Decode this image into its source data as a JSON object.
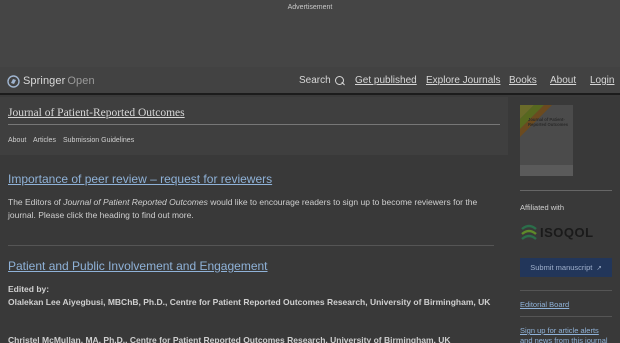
{
  "advertisement": {
    "label": "Advertisement"
  },
  "header": {
    "logo": {
      "brand": "Springer",
      "suffix": "Open"
    },
    "nav": {
      "search": "Search",
      "get_published": "Get published",
      "explore_journals": "Explore Journals",
      "books": "Books",
      "about": "About",
      "login": "Login"
    }
  },
  "journal": {
    "title": "Journal of Patient-Reported Outcomes",
    "subnav": [
      "About",
      "Articles",
      "Submission Guidelines"
    ]
  },
  "main": {
    "article1": {
      "heading": "Importance of peer review – request for reviewers",
      "text_before": "The Editors of ",
      "text_italic": "Journal of Patient Reported Outcomes",
      "text_after": " would like to encourage readers to sign up to become reviewers for the journal.  Please click the heading to find out more."
    },
    "article2": {
      "heading": "Patient and Public Involvement and Engagement",
      "edited_by": "Edited by:",
      "editor1": "Olalekan Lee Aiyegbusi, MBChB, Ph.D., Centre for Patient Reported Outcomes Research, University of Birmingham, UK",
      "editor2": "Christel McMullan, MA, Ph.D., Centre for Patient Reported Outcomes Research, University of Birmingham, UK"
    }
  },
  "sidebar": {
    "cover_title": "Journal of Patient-Reported Outcomes",
    "affiliated_with": "Affiliated with",
    "isoqol_name": "ISOQOL",
    "submit_button": "Submit manuscript",
    "editorial_board": "Editorial Board",
    "signup_alerts": "Sign up for article alerts and news from this journal"
  },
  "colors": {
    "link": "#8fb2d8",
    "submit_bg": "#22365a",
    "overlay_gray": "#3a3a3a"
  }
}
